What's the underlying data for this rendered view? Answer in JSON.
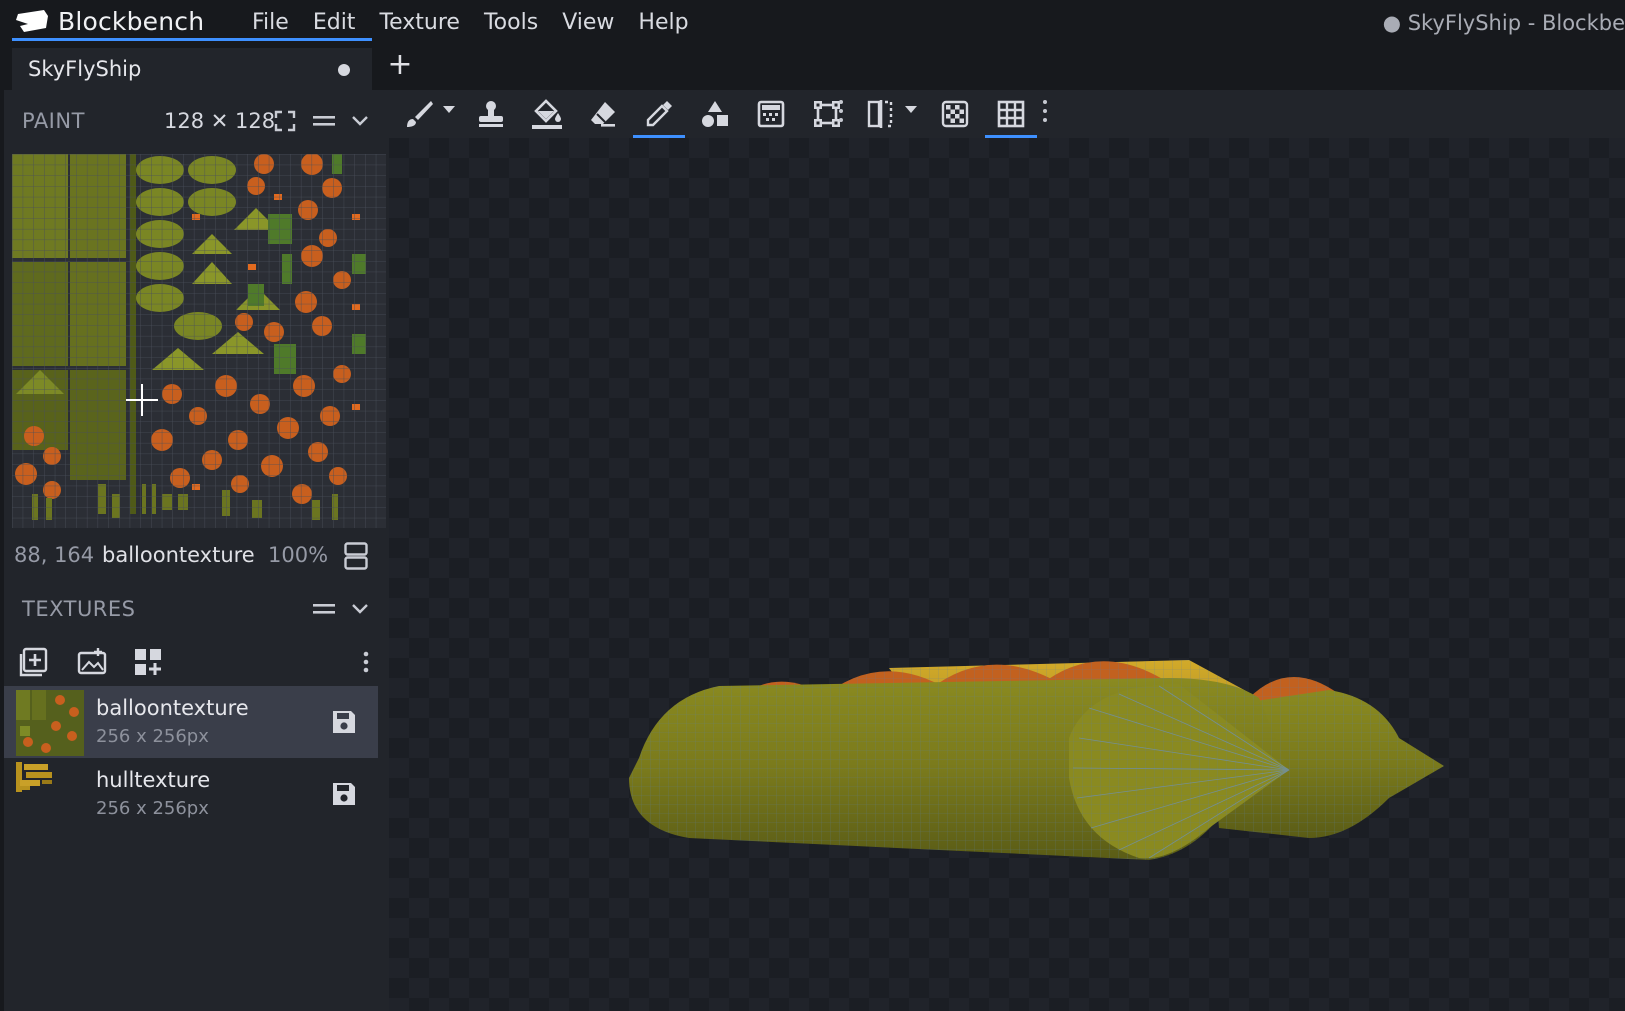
{
  "app": {
    "brand": "Blockbench",
    "window_title": "● SkyFlyShip - Blockbe"
  },
  "menu": [
    "File",
    "Edit",
    "Texture",
    "Tools",
    "View",
    "Help"
  ],
  "tabs": [
    {
      "label": "SkyFlyShip",
      "unsaved": true
    }
  ],
  "paint_panel": {
    "title": "PAINT",
    "canvas_size": "128 ✕ 128",
    "status": {
      "coords": "88, 164",
      "texture": "balloontexture",
      "zoom": "100%"
    }
  },
  "textures_panel": {
    "title": "TEXTURES",
    "items": [
      {
        "name": "balloontexture",
        "size": "256 x 256px",
        "selected": true
      },
      {
        "name": "hulltexture",
        "size": "256 x 256px",
        "selected": false
      }
    ]
  },
  "toolbar": {
    "tools": [
      "brush-icon",
      "stamp-icon",
      "fill-icon",
      "eraser-icon",
      "color-picker-icon",
      "shapes-icon",
      "gradient-icon",
      "selection-icon",
      "mirror-icon",
      "lock-alpha-icon",
      "grid-icon"
    ],
    "active_tool": "color-picker-icon"
  },
  "colors": {
    "accent": "#3e90ff",
    "model_green": "#7a7a1e",
    "model_orange": "#c2611f",
    "model_yellow": "#b89a22"
  }
}
